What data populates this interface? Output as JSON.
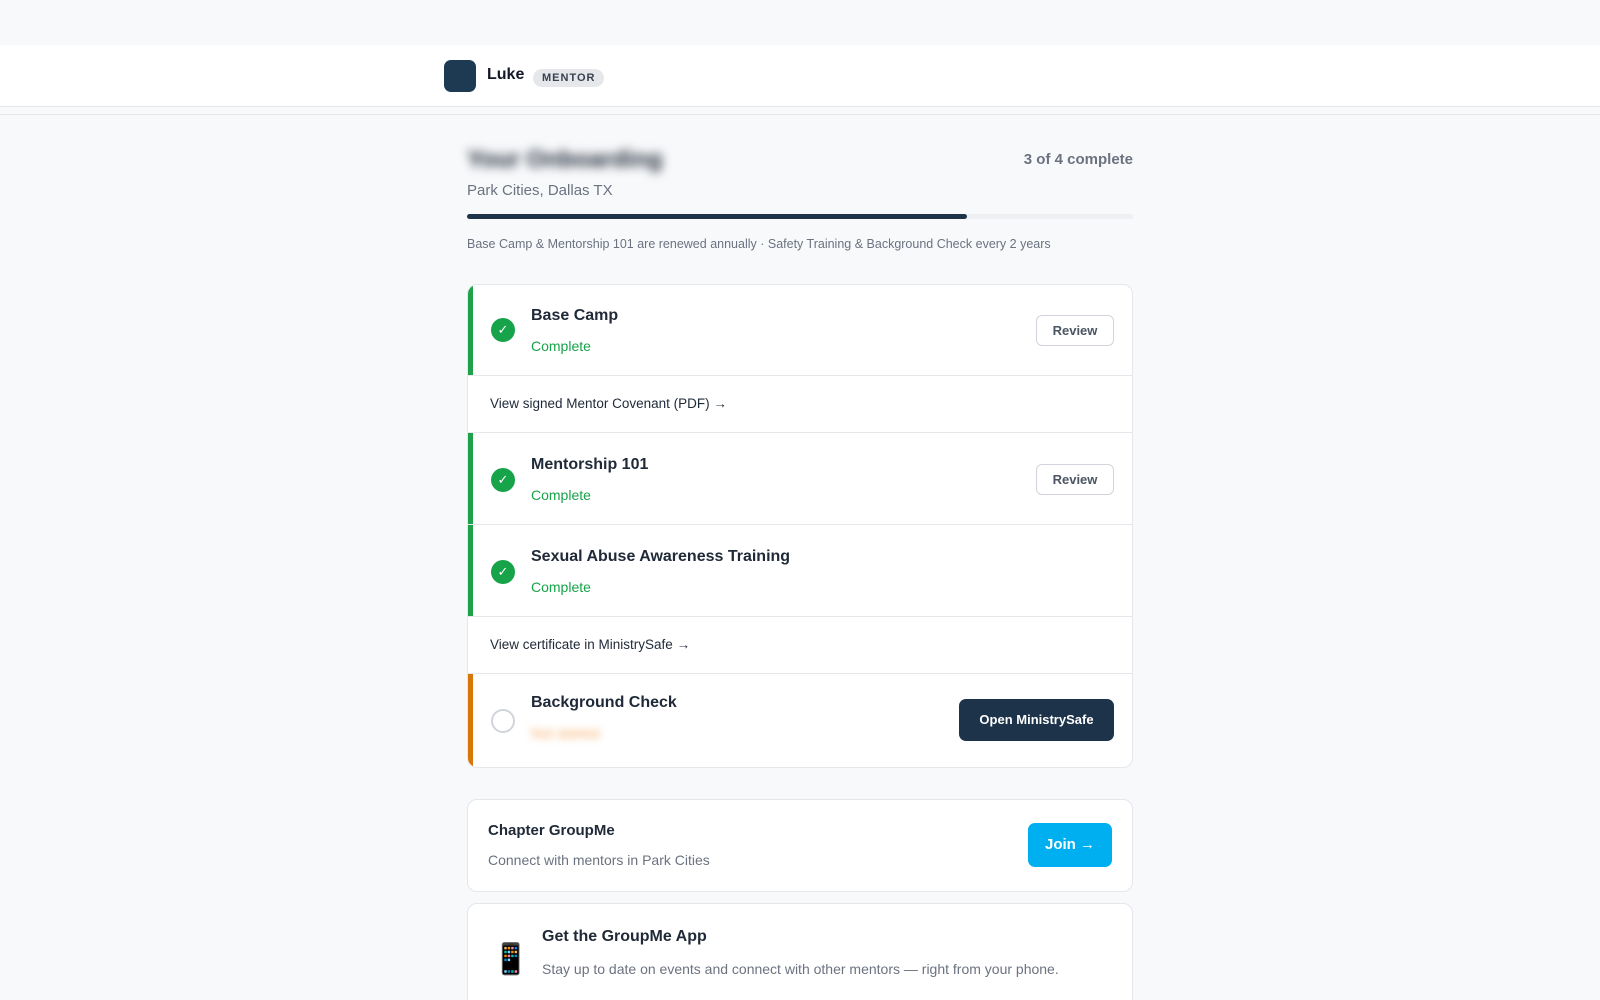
{
  "header": {
    "username": "Luke",
    "role": "MENTOR"
  },
  "onboarding": {
    "title": "Your Onboarding",
    "progress_text": "3 of 4 complete",
    "progress_fraction": 0.75,
    "location": "Park Cities, Dallas TX",
    "renewal_note": "Base Camp & Mentorship 101 are renewed annually · Safety Training & Background Check every 2 years"
  },
  "steps": [
    {
      "name": "Base Camp",
      "status": "Complete",
      "action": "Review",
      "state": "complete"
    },
    {
      "link": "View signed Mentor Covenant (PDF) →"
    },
    {
      "name": "Mentorship 101",
      "status": "Complete",
      "action": "Review",
      "state": "complete"
    },
    {
      "name": "Sexual Abuse Awareness Training",
      "status": "Complete",
      "state": "complete"
    },
    {
      "link": "View certificate in MinistrySafe →"
    },
    {
      "name": "Background Check",
      "status": "Not started",
      "action": "Open MinistrySafe",
      "state": "pending"
    }
  ],
  "icons": {
    "check": "✓",
    "phone": "📱"
  },
  "groupme": {
    "title": "Chapter GroupMe",
    "subtitle": "Connect with mentors in Park Cities",
    "join_label": "Join →"
  },
  "app_promo": {
    "title": "Get the GroupMe App",
    "description": "Stay up to date on events and connect with other mentors — right from your phone."
  },
  "colors": {
    "complete": "#16a34a",
    "pending": "#d97706",
    "primary": "#1c3349",
    "groupme": "#00aff0"
  }
}
